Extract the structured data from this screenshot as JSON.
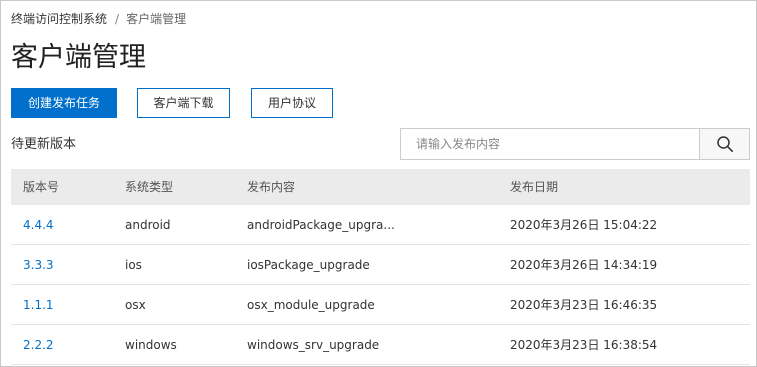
{
  "breadcrumb": {
    "root": "终端访问控制系统",
    "separator": "/",
    "current": "客户端管理"
  },
  "page": {
    "title": "客户端管理"
  },
  "toolbar": {
    "create_label": "创建发布任务",
    "download_label": "客户端下载",
    "agreement_label": "用户协议"
  },
  "section": {
    "title": "待更新版本"
  },
  "search": {
    "placeholder": "请输入发布内容",
    "value": "",
    "icon": "search-icon"
  },
  "table": {
    "columns": [
      "版本号",
      "系统类型",
      "发布内容",
      "发布日期"
    ],
    "rows": [
      {
        "version": "4.4.4",
        "os": "android",
        "content": "androidPackage_upgra...",
        "date": "2020年3月26日 15:04:22"
      },
      {
        "version": "3.3.3",
        "os": "ios",
        "content": "iosPackage_upgrade",
        "date": "2020年3月26日 14:34:19"
      },
      {
        "version": "1.1.1",
        "os": "osx",
        "content": "osx_module_upgrade",
        "date": "2020年3月23日 16:46:35"
      },
      {
        "version": "2.2.2",
        "os": "windows",
        "content": "windows_srv_upgrade",
        "date": "2020年3月23日 16:38:54"
      }
    ]
  },
  "colors": {
    "primary": "#0070cc",
    "header_bg": "#ebebeb",
    "link": "#0070cc"
  }
}
